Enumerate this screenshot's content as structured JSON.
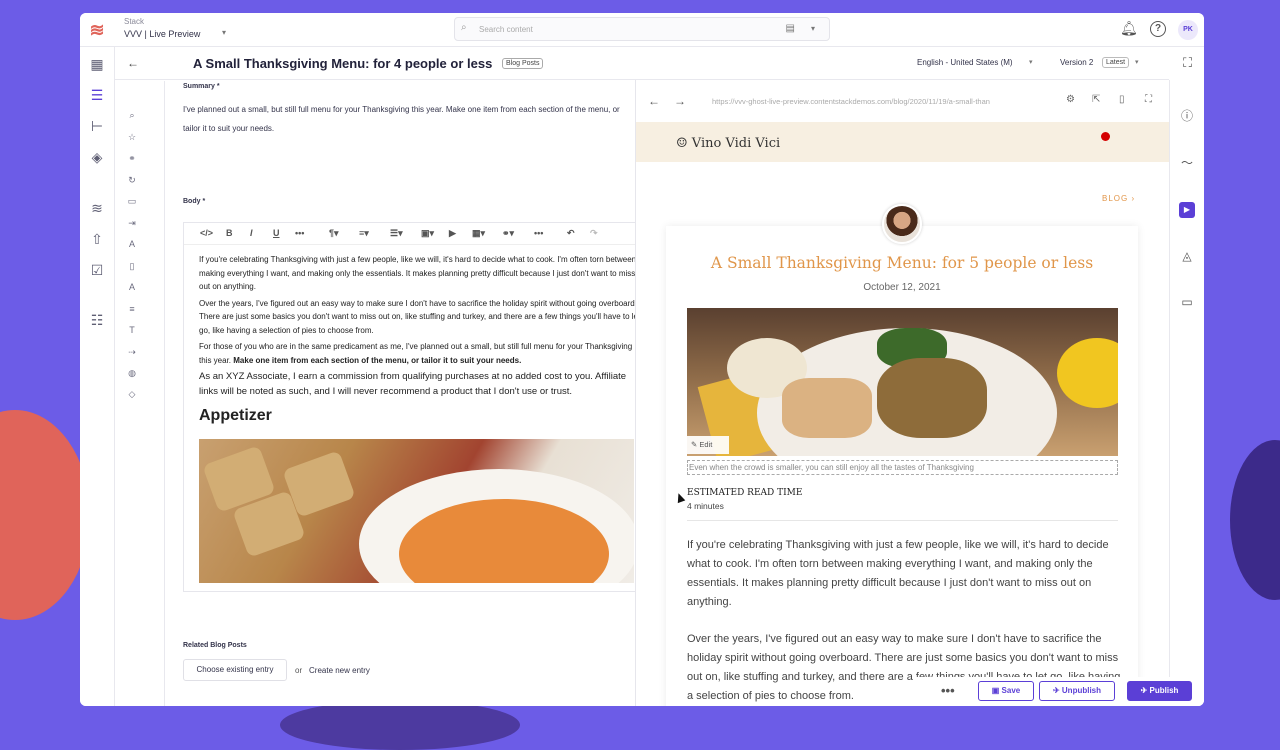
{
  "app": {
    "stack_label": "Stack",
    "stack_name": "VVV | Live Preview",
    "search_placeholder": "Search content",
    "user_initials": "PK"
  },
  "header": {
    "title": "A Small Thanksgiving Menu: for 4 people or less",
    "content_type": "Blog Posts",
    "locale": "English - United States (M)",
    "version": "Version 2",
    "version_badge": "Latest"
  },
  "form": {
    "summary_label": "Summary *",
    "summary_text": "I've planned out a small, but still full menu for your Thanksgiving this year. Make one item from each section of the menu, or tailor it to suit your needs.",
    "body_label": "Body *",
    "body_p1": "If you're celebrating Thanksgiving with just a few people, like we will, it's hard to decide what to cook. I'm often torn between making everything I want, and making only the essentials. It makes planning pretty difficult because I just don't want to miss out on anything.",
    "body_p2": "Over the years, I've figured out an easy way to make sure I don't have to sacrifice the holiday spirit without going overboard. There are just some basics you don't want to miss out on, like stuffing and turkey, and there are a few things you'll have to let go, like having a selection of pies to choose from.",
    "body_p3a": "For those of you who are in the same predicament as me, I've planned out a small, but still full menu for your Thanksgiving this year. ",
    "body_p3b": "Make one item from each section of the menu, or tailor it to suit your needs.",
    "body_p4": "As an XYZ Associate, I earn a commission from qualifying purchases at no added cost to you. Affiliate links will be noted as such, and I will never recommend a product that I don't use or trust.",
    "appetizer_heading": "Appetizer",
    "related_label": "Related Blog Posts",
    "choose_existing": "Choose existing entry",
    "or": "or",
    "create_new": "Create new entry"
  },
  "preview": {
    "url": "https://vvv-ghost-live-preview.contentstackdemos.com/blog/2020/11/19/a-small-than",
    "site_name": "Vino Vidi Vici",
    "blog_link": "BLOG",
    "article_title": "A Small Thanksgiving Menu: for 5 people or less",
    "article_date": "October 12, 2021",
    "edit_label": "Edit",
    "caption": "Even when the crowd is smaller, you can still enjoy all the tastes of Thanksgiving",
    "read_time_label": "ESTIMATED READ TIME",
    "read_time_value": "4 minutes",
    "para1": "If you're celebrating Thanksgiving with just a few people, like we will, it's hard to decide what to cook. I'm often torn between making everything I want, and making only the essentials. It makes planning pretty difficult because I just don't want to miss out on anything.",
    "para2": "Over the years, I've figured out an easy way to make sure I don't have to sacrifice the holiday spirit without going overboard. There are just some basics you don't want to miss out on, like stuffing and turkey, and there are a few things you'll have to let go, like having a selection of pies to choose from."
  },
  "actions": {
    "save": "Save",
    "unpublish": "Unpublish",
    "publish": "Publish"
  },
  "colors": {
    "brand": "#5b3fd6",
    "accent_orange": "#e0964a"
  }
}
